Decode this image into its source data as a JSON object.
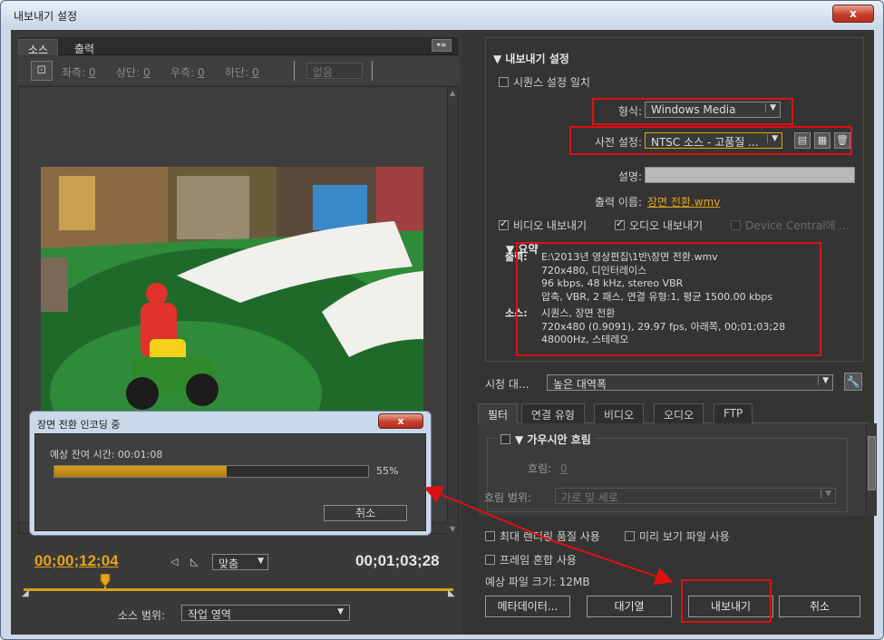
{
  "window": {
    "title": "내보내기 설정",
    "close_glyph": "x"
  },
  "left": {
    "tabs": [
      "소스",
      "출력"
    ],
    "panel_menu_glyph": "▾≡",
    "crop": {
      "icon_glyph": "⊡",
      "items": [
        {
          "label": "좌측:",
          "value": "0"
        },
        {
          "label": "상단:",
          "value": "0"
        },
        {
          "label": "우측:",
          "value": "0"
        },
        {
          "label": "하단:",
          "value": "0"
        }
      ],
      "dropdown": "없음"
    },
    "timecode_current": "00;00;12;04",
    "timecode_duration": "00;01;03;28",
    "mark_in_glyph": "◁",
    "mark_out_glyph": "◺",
    "fit": "맞춤",
    "source_range_label": "소스 범위:",
    "source_range_value": "작업 영역",
    "playhead_fraction": 0.19
  },
  "encoding": {
    "title": "장면 전환 인코딩 중",
    "close_glyph": "x",
    "remaining_label": "예상 잔여 시간: 00:01:08",
    "progress_percent": 55,
    "progress_text": "55%",
    "cancel": "취소"
  },
  "right": {
    "export_settings_header": "▼ 내보내기 설정",
    "match_sequence": "시퀀스 설정 일치",
    "format_label": "형식:",
    "format_value": "Windows Media",
    "preset_label": "사전 설정:",
    "preset_value": "NTSC 소스 - 고품질 ...",
    "comments_label": "설명:",
    "output_name_label": "출력 이름:",
    "output_name_value": "장면 전환.wmv",
    "export_video": "비디오 내보내기",
    "export_audio": "오디오 내보내기",
    "device_central": "Device Central에 ...",
    "summary_header": "▼ 요약",
    "summary": {
      "output_key": "출력:",
      "output_lines": [
        "E:\\2013년 영상편집\\1반\\장면 전환.wmv",
        "720x480, 디인터레이스",
        "96 kbps, 48 kHz, stereo VBR",
        "압축, VBR, 2 패스, 연결 유형:1, 평균 1500.00 kbps"
      ],
      "source_key": "소스:",
      "source_lines": [
        "시퀀스, 장면 전환",
        "720x480 (0.9091), 29.97 fps, 아래쪽, 00;01;03;28",
        "48000Hz, 스테레오"
      ]
    },
    "viewer_label": "시청 대...",
    "viewer_value": "높은 대역폭",
    "wrench_glyph": "🔧",
    "tabs": [
      "필터",
      "연결 유형",
      "비디오",
      "오디오",
      "FTP"
    ],
    "gaussian_header": "▼ 가우시안 흐림",
    "blur_label": "흐림:",
    "blur_value": "0",
    "blur_dim_label": "흐림 범위:",
    "blur_dim_value": "가로 및 세로",
    "max_render_quality": "최대 렌더링 품질 사용",
    "use_previews": "미리 보기 파일 사용",
    "frame_blending": "프레임 혼합 사용",
    "file_size": "예상 파일 크기: 12MB",
    "buttons": {
      "metadata": "메타데이터...",
      "queue": "대기열",
      "export": "내보내기",
      "cancel": "취소"
    }
  },
  "colors": {
    "accent": "#e3a31a",
    "annotation": "#e01010"
  }
}
